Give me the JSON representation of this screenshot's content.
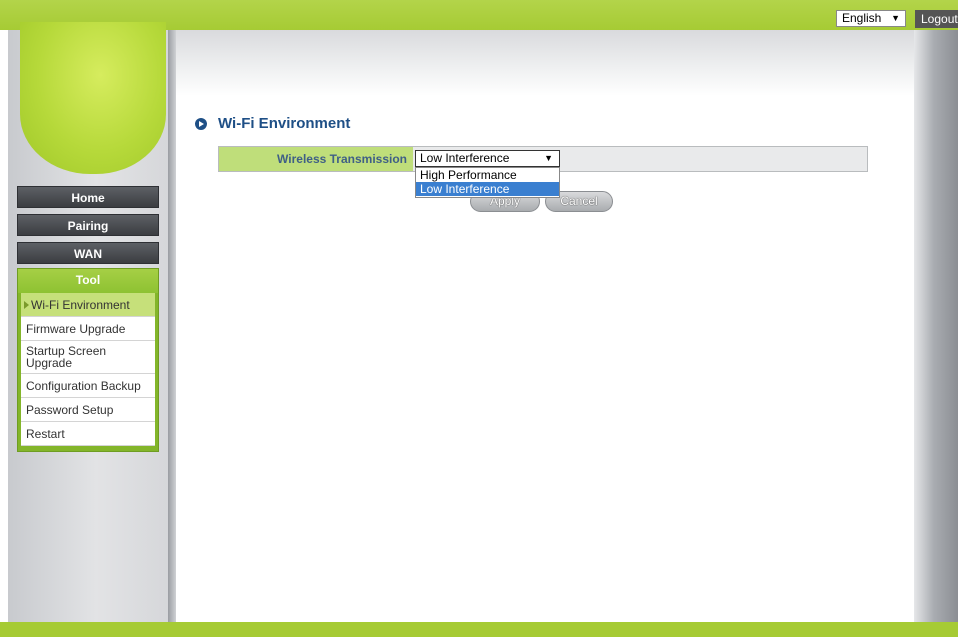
{
  "header": {
    "language": "English",
    "logout_label": "Logout"
  },
  "nav": {
    "items": [
      {
        "label": "Home"
      },
      {
        "label": "Pairing"
      },
      {
        "label": "WAN"
      }
    ],
    "tool": {
      "label": "Tool",
      "items": [
        {
          "label": "Wi-Fi Environment",
          "active": true
        },
        {
          "label": "Firmware Upgrade"
        },
        {
          "label": "Startup Screen Upgrade"
        },
        {
          "label": "Configuration Backup"
        },
        {
          "label": "Password Setup"
        },
        {
          "label": "Restart"
        }
      ]
    }
  },
  "main": {
    "title": "Wi-Fi Environment",
    "wireless_transmission": {
      "label": "Wireless Transmission",
      "selected": "Low Interference",
      "options": [
        "High Performance",
        "Low Interference"
      ]
    },
    "apply_label": "Apply",
    "cancel_label": "Cancel"
  },
  "colors": {
    "brand_green": "#a6cb34",
    "title_blue": "#1e4f86",
    "highlight_blue": "#3a7fd0"
  }
}
